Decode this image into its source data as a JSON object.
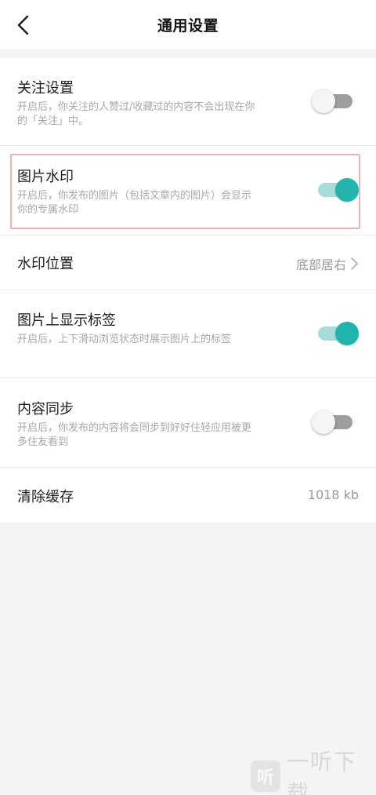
{
  "header": {
    "title": "通用设置"
  },
  "settings": [
    {
      "label": "关注设置",
      "desc": "开启后，你关注的人赞过/收藏过的内容不会出现在你的「关注」中。",
      "toggle": "off"
    },
    {
      "label": "图片水印",
      "desc": "开启后，你发布的图片（包括文章内的图片）会显示你的专属水印",
      "toggle": "on"
    },
    {
      "label": "水印位置",
      "value": "底部居右"
    },
    {
      "label": "图片上显示标签",
      "desc": "开启后，上下滑动浏览状态时展示图片上的标签",
      "toggle": "on"
    },
    {
      "label": "内容同步",
      "desc": "开启后，你发布的内容将会同步到好好住轻应用被更多住友看到",
      "toggle": "off"
    },
    {
      "label": "清除缓存",
      "value": "1018 kb"
    }
  ],
  "colors": {
    "toggle_on_knob": "#23b3ad",
    "toggle_on_track": "#a8dcd8",
    "toggle_off_track": "#9e9e9e",
    "highlight_border": "#eab4b4"
  },
  "icons": {
    "back": "chevron-left-icon",
    "watermark_logo": "ting-logo-icon"
  },
  "watermark": {
    "logo_char": "听",
    "text": "一听下载"
  }
}
